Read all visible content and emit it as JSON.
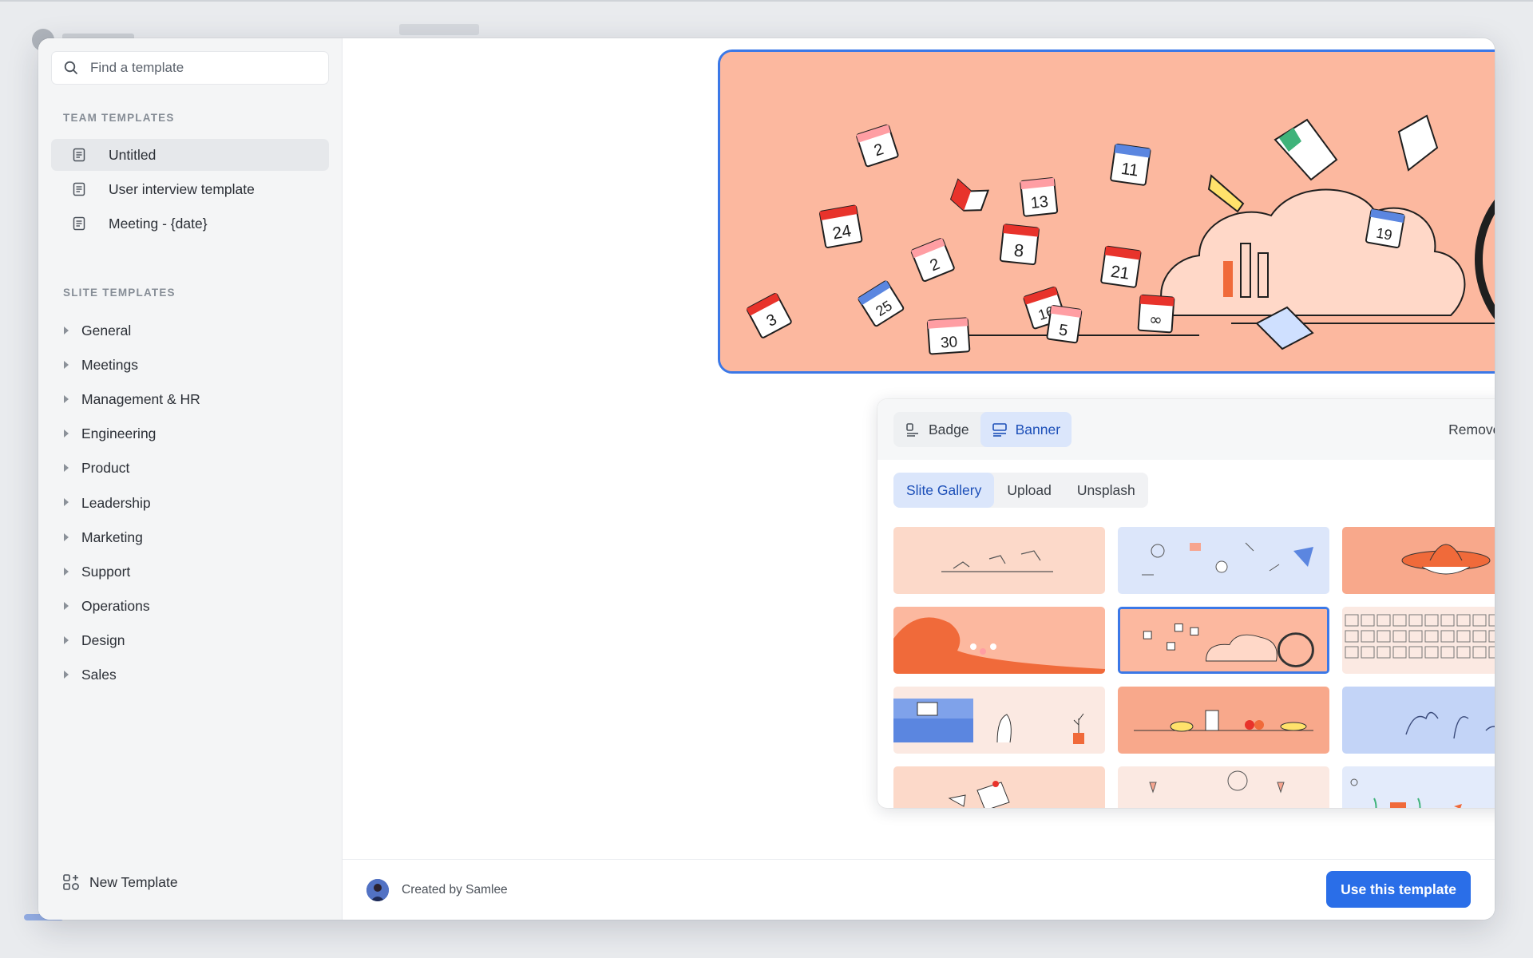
{
  "search": {
    "placeholder": "Find a template"
  },
  "team_templates": {
    "label": "TEAM TEMPLATES",
    "items": [
      {
        "label": "Untitled",
        "active": true
      },
      {
        "label": "User interview template"
      },
      {
        "label": "Meeting - {date}"
      }
    ]
  },
  "slite_templates": {
    "label": "SLITE TEMPLATES",
    "categories": [
      "General",
      "Meetings",
      "Management & HR",
      "Engineering",
      "Product",
      "Leadership",
      "Marketing",
      "Support",
      "Operations",
      "Design",
      "Sales"
    ]
  },
  "sidebar_footer": {
    "new_template_label": "New Template"
  },
  "cover": {
    "calendar_numbers": [
      "2",
      "24",
      "13",
      "11",
      "8",
      "2",
      "21",
      "3",
      "25",
      "30",
      "16",
      "5",
      "19",
      "∞"
    ]
  },
  "picker": {
    "badge_label": "Badge",
    "banner_label": "Banner",
    "remove_cover_label": "Remove cover",
    "tabs": [
      "Slite Gallery",
      "Upload",
      "Unsplash"
    ],
    "selected_tab": "Slite Gallery",
    "selected_style": "Banner"
  },
  "footer": {
    "created_by": "Created by Samlee",
    "use_button": "Use this template"
  },
  "colors": {
    "accent": "#2a6ee8",
    "selection": "#3b78e7",
    "cover_bg": "#fcb89f"
  }
}
